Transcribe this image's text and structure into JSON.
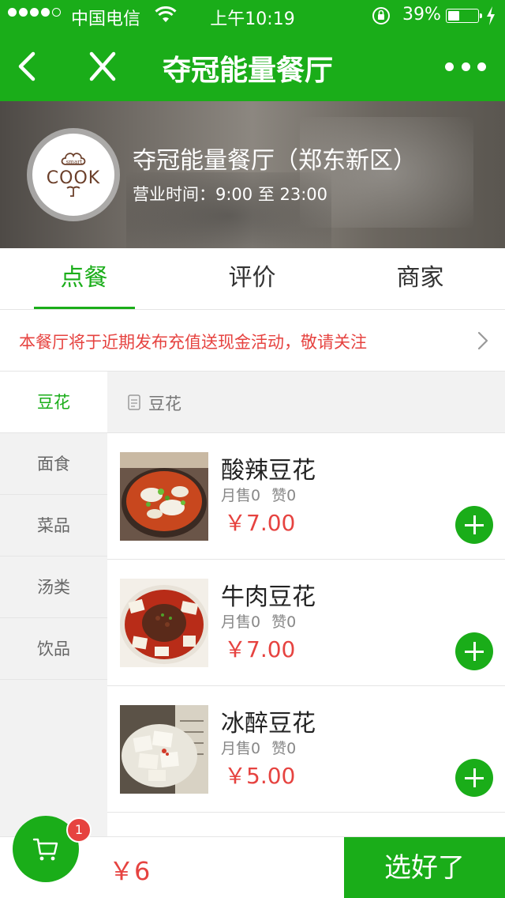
{
  "status_bar": {
    "carrier": "中国电信",
    "time": "上午10:19",
    "battery_text": "39%",
    "battery_level": 0.39,
    "signal_bars": 4,
    "signal_total": 5
  },
  "nav": {
    "title": "夺冠能量餐厅"
  },
  "header": {
    "shop_name": "夺冠能量餐厅（郑东新区）",
    "hours": "营业时间：9:00 至 23:00",
    "logo_text": "COOK",
    "logo_small_text": "smart"
  },
  "tabs": [
    {
      "label": "点餐",
      "active": true
    },
    {
      "label": "评价",
      "active": false
    },
    {
      "label": "商家",
      "active": false
    }
  ],
  "notice": {
    "text": "本餐厅将于近期发布充值送现金活动，敬请关注"
  },
  "sidebar": {
    "items": [
      {
        "label": "豆花",
        "active": true
      },
      {
        "label": "面食",
        "active": false
      },
      {
        "label": "菜品",
        "active": false
      },
      {
        "label": "汤类",
        "active": false
      },
      {
        "label": "饮品",
        "active": false
      }
    ]
  },
  "category": {
    "label": "豆花"
  },
  "dishes": [
    {
      "name": "酸辣豆花",
      "sales": "月售0",
      "likes": "赞0",
      "price": "￥7.00"
    },
    {
      "name": "牛肉豆花",
      "sales": "月售0",
      "likes": "赞0",
      "price": "￥7.00"
    },
    {
      "name": "冰醉豆花",
      "sales": "月售0",
      "likes": "赞0",
      "price": "￥5.00"
    }
  ],
  "cart": {
    "count": "1",
    "total": "￥6",
    "submit_label": "选好了"
  },
  "colors": {
    "brand_green": "#1aad19",
    "price_red": "#e64340",
    "badge_red": "#e64340"
  },
  "icons": {
    "back": "chevron-left-icon",
    "close": "close-icon",
    "more": "more-dots-icon",
    "cart": "cart-icon",
    "add": "plus-icon",
    "arrow": "chevron-right-icon",
    "category": "menu-list-icon"
  }
}
